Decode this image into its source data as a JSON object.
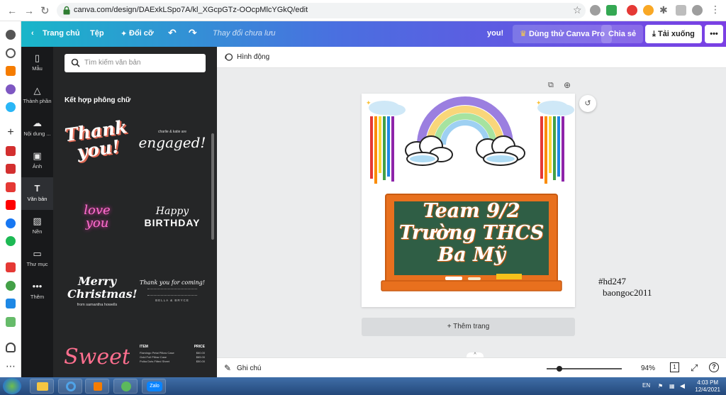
{
  "browser": {
    "url": "canva.com/design/DAExkLSpo7A/kl_XGcpGTz-OOcpMlcYGkQ/edit"
  },
  "topbar": {
    "home": "Trang chủ",
    "file": "Tệp",
    "resize": "Đổi cỡ",
    "save_status": "Thay đổi chưa lưu",
    "you": "you!",
    "try_pro": "Dùng thử Canva Pro",
    "share": "Chia sẻ",
    "download": "Tải xuống"
  },
  "sidenav": {
    "items": [
      {
        "label": "Mẫu",
        "icon": "template-icon"
      },
      {
        "label": "Thành phần",
        "icon": "elements-icon"
      },
      {
        "label": "Nội dung ...",
        "icon": "upload-icon"
      },
      {
        "label": "Ảnh",
        "icon": "photo-icon"
      },
      {
        "label": "Văn bản",
        "icon": "text-icon"
      },
      {
        "label": "Nền",
        "icon": "background-icon"
      },
      {
        "label": "Thư mục",
        "icon": "folder-icon"
      },
      {
        "label": "Thêm",
        "icon": "more-icon"
      }
    ]
  },
  "panel": {
    "search_placeholder": "Tìm kiếm văn bản",
    "section_title": "Kết hợp phông chữ",
    "tiles": {
      "thank": "Thank you!",
      "engaged_small": "charlie & katie are",
      "engaged": "engaged!",
      "love": "love you",
      "happy": "Happy",
      "birthday": "BIRTHDAY",
      "merry": "Merry Christmas!",
      "merry_sub": "from samantha howells",
      "thanks_coming": "Thank you for coming!",
      "thanks_coming_sub": "BELLA & BRYCE",
      "sweet": "Sweet",
      "menu_item": "ITEM",
      "menu_price": "PRICE",
      "menu_rows": [
        {
          "name": "Flamingo Petal Pillow Case",
          "price": "$60.00"
        },
        {
          "name": "Gold Foil Pillow Case",
          "price": "$65.00"
        },
        {
          "name": "Polka Dots Fitted Sheet",
          "price": "$50.00"
        }
      ]
    }
  },
  "workspace": {
    "animation": "Hình động",
    "board_lines": [
      "Team 9/2",
      "Trường THCS",
      "Ba Mỹ"
    ],
    "add_page": "+ Thêm trang",
    "notes": "Ghi chú",
    "zoom": "94%",
    "page_count": "1",
    "watermark_tag": "#hd247",
    "watermark_user": "baongoc2011"
  },
  "taskbar": {
    "lang": "EN",
    "time": "4:03 PM",
    "date": "12/4/2021",
    "zalo": "Zalo"
  },
  "colors": {
    "board_frame": "#e8701e",
    "board_green": "#2f5e45",
    "accent_purple": "#7b3fe4",
    "accent_teal": "#19b6c9"
  }
}
